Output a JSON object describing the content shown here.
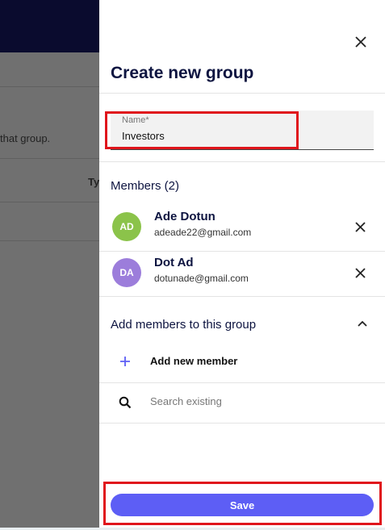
{
  "background": {
    "partial_text": "that group.",
    "partial_column_header": "Ty"
  },
  "drawer": {
    "title": "Create new group",
    "name_field": {
      "label": "Name*",
      "value": "Investors"
    },
    "members": {
      "heading": "Members (2)",
      "items": [
        {
          "initials": "AD",
          "name": "Ade Dotun",
          "email": "adeade22@gmail.com",
          "avatar_color": "#8bc34a"
        },
        {
          "initials": "DA",
          "name": "Dot Ad",
          "email": "dotunade@gmail.com",
          "avatar_color": "#9c7ddb"
        }
      ]
    },
    "add_section": {
      "heading": "Add members to this group",
      "add_new_label": "Add new member",
      "search_placeholder": "Search existing"
    },
    "save_label": "Save"
  },
  "colors": {
    "accent": "#5d5ef5",
    "title": "#0d1440",
    "highlight": "#e0151c"
  },
  "icons": [
    "close-icon",
    "chevron-up-icon",
    "plus-icon",
    "search-icon"
  ]
}
